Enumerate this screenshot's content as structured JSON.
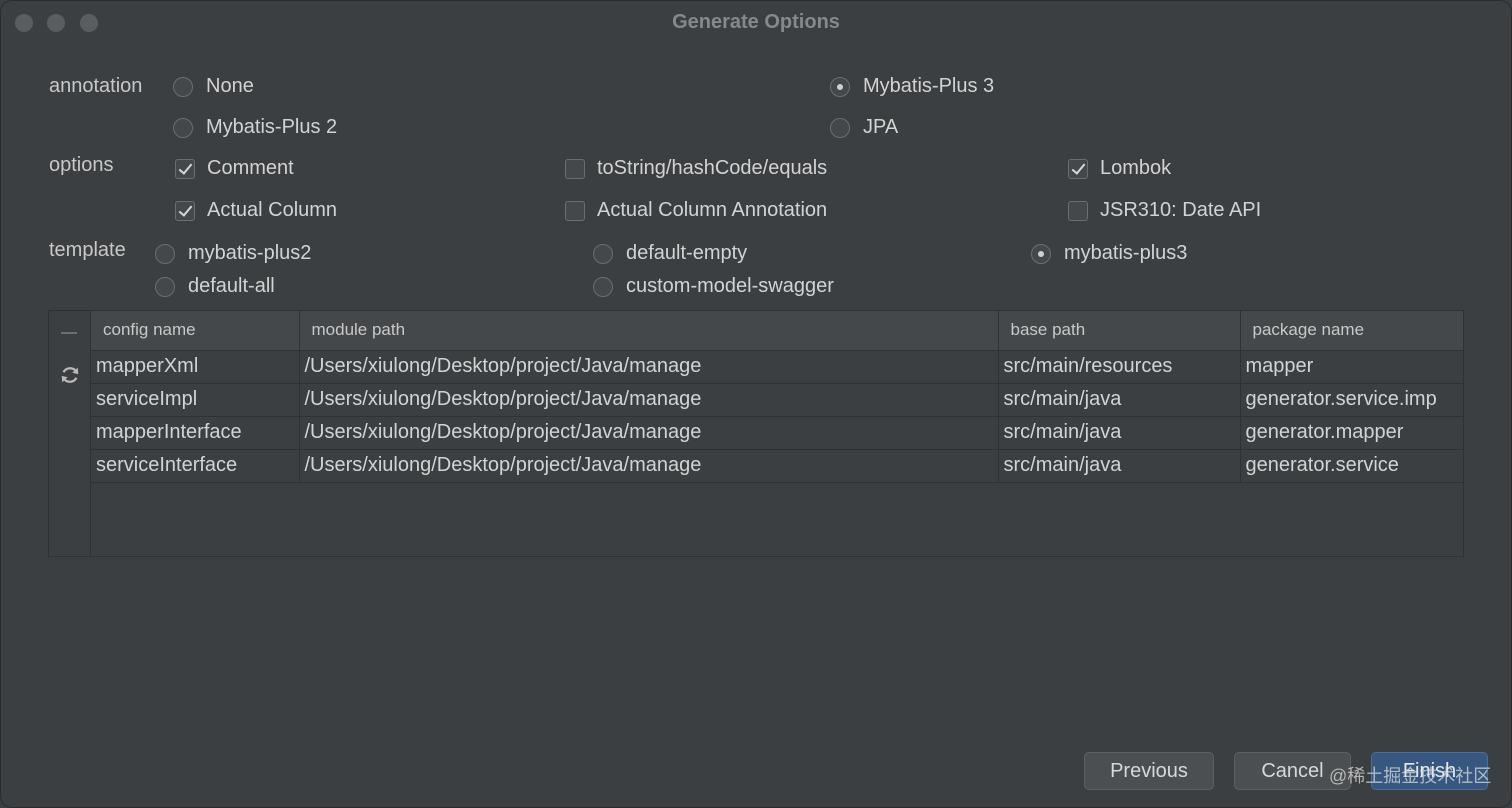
{
  "window": {
    "title": "Generate Options"
  },
  "annotation": {
    "label": "annotation",
    "options": [
      {
        "label": "None",
        "selected": false
      },
      {
        "label": "Mybatis-Plus 3",
        "selected": true
      },
      {
        "label": "Mybatis-Plus 2",
        "selected": false
      },
      {
        "label": "JPA",
        "selected": false
      }
    ]
  },
  "options": {
    "label": "options",
    "items": [
      {
        "label": "Comment",
        "checked": true
      },
      {
        "label": "toString/hashCode/equals",
        "checked": false
      },
      {
        "label": "Lombok",
        "checked": true
      },
      {
        "label": "Actual Column",
        "checked": true
      },
      {
        "label": "Actual Column Annotation",
        "checked": false
      },
      {
        "label": "JSR310: Date API",
        "checked": false
      }
    ]
  },
  "template": {
    "label": "template",
    "options": [
      {
        "label": "mybatis-plus2",
        "selected": false
      },
      {
        "label": "default-empty",
        "selected": false
      },
      {
        "label": "mybatis-plus3",
        "selected": true
      },
      {
        "label": "default-all",
        "selected": false
      },
      {
        "label": "custom-model-swagger",
        "selected": false
      }
    ]
  },
  "table": {
    "headers": [
      "config name",
      "module path",
      "base path",
      "package name"
    ],
    "rows": [
      [
        "mapperXml",
        "/Users/xiulong/Desktop/project/Java/manage",
        "src/main/resources",
        "mapper"
      ],
      [
        "serviceImpl",
        "/Users/xiulong/Desktop/project/Java/manage",
        "src/main/java",
        "generator.service.imp"
      ],
      [
        "mapperInterface",
        "/Users/xiulong/Desktop/project/Java/manage",
        "src/main/java",
        "generator.mapper"
      ],
      [
        "serviceInterface",
        "/Users/xiulong/Desktop/project/Java/manage",
        "src/main/java",
        "generator.service"
      ]
    ]
  },
  "buttons": {
    "previous": "Previous",
    "cancel": "Cancel",
    "finish": "Finish"
  },
  "watermark": "@稀土掘金技术社区",
  "colors": {
    "background": "#3c3f41",
    "primary_button": "#365880"
  }
}
